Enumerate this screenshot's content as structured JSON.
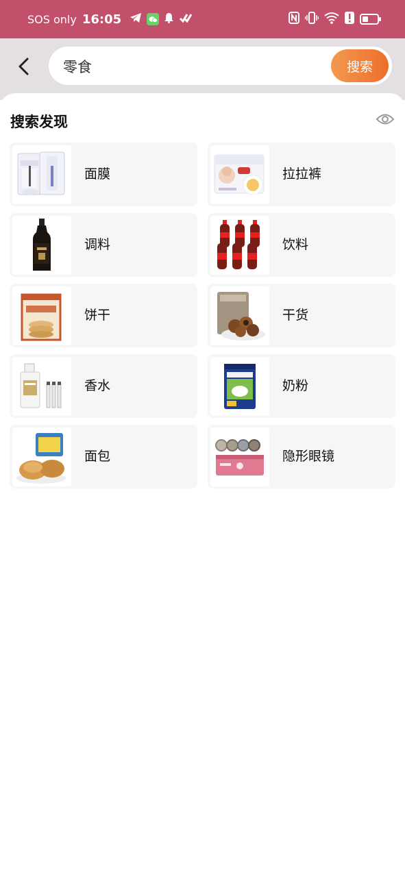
{
  "status_bar": {
    "carrier": "SOS only",
    "time": "16:05",
    "icons_left": [
      "telegram-icon",
      "wechat-icon",
      "bell-icon",
      "app-check-icon"
    ],
    "icons_right": [
      "nfc-icon",
      "vibrate-icon",
      "wifi-icon",
      "alert-icon",
      "battery-icon"
    ],
    "battery_level": 0.3
  },
  "search": {
    "value": "零食",
    "button_label": "搜索",
    "accent": "#ec6e2c"
  },
  "discovery": {
    "title": "搜索发现",
    "visibility_icon": "eye-icon",
    "items": [
      {
        "label": "面膜",
        "icon": "face-mask-product"
      },
      {
        "label": "拉拉裤",
        "icon": "diaper-product"
      },
      {
        "label": "调料",
        "icon": "sauce-bottle-product"
      },
      {
        "label": "饮料",
        "icon": "cola-bottles-product"
      },
      {
        "label": "饼干",
        "icon": "biscuit-box-product"
      },
      {
        "label": "干货",
        "icon": "dried-longan-product"
      },
      {
        "label": "香水",
        "icon": "perfume-product"
      },
      {
        "label": "奶粉",
        "icon": "milk-powder-product"
      },
      {
        "label": "面包",
        "icon": "bread-product"
      },
      {
        "label": "隐形眼镜",
        "icon": "contact-lens-product"
      }
    ]
  },
  "colors": {
    "status_bar": "#c2506a",
    "header_bg": "#e4dfe2",
    "card_bg": "#f6f6f6"
  }
}
